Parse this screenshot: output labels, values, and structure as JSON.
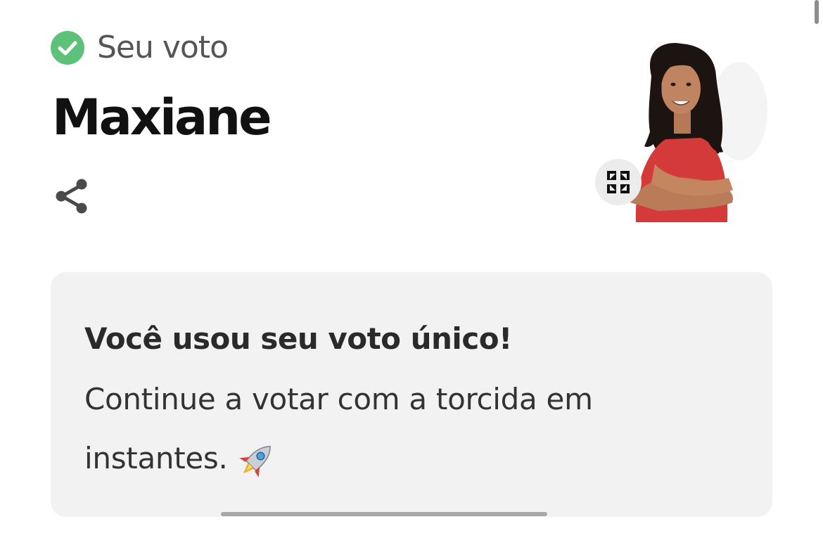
{
  "vote_status": {
    "label": "Seu voto",
    "icon": "check-circle-icon",
    "color": "#5cc27a"
  },
  "candidate": {
    "name": "Maxiane",
    "photo": "candidate-photo",
    "share_icon": "share-icon",
    "expand_icon": "expand-icon"
  },
  "message": {
    "title": "Você usou seu voto único!",
    "body": "Continue a votar com a torcida em instantes.",
    "emoji_icon": "rocket-icon"
  },
  "colors": {
    "card_background": "#f2f2f2",
    "text_primary": "#111111",
    "text_secondary": "#555555"
  }
}
